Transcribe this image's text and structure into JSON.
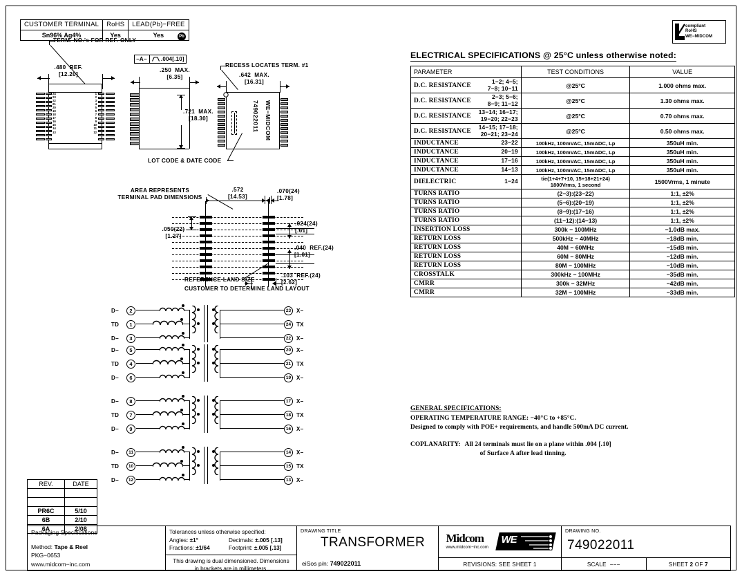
{
  "compliance": {
    "headers": [
      "CUSTOMER  TERMINAL",
      "RoHS",
      "LEAD(Pb)−FREE"
    ],
    "values": [
      "Sn96% Ag4%",
      "Yes",
      "Yes"
    ],
    "pb_badge": "Pb"
  },
  "rohs_logo": {
    "line1": "compliant",
    "line2": "RoHS",
    "line3": "WE−MIDCOM"
  },
  "mechanical": {
    "note_term_ref": "TERM. NO.'s FOR REF. ONLY",
    "note_recess": "RECESS LOCATES TERM. #1",
    "note_lotcode": "LOT CODE & DATE CODE",
    "width_ref": ".480  REF.\n[12.20]",
    "datum": "−A−",
    "flatness": ".004[.10]",
    "height_max": ".250  MAX.\n[6.35]",
    "depth_max": ".721  MAX.\n[18.30]",
    "len_max": ".642  MAX.\n[16.31]",
    "body_brand": "WE−MIDCOM",
    "body_pn": "749022011",
    "terminals_left": [
      "24",
      "23",
      "22",
      "21",
      "20",
      "19",
      "18",
      "17",
      "16",
      "15",
      "14",
      "13"
    ],
    "terminals_right": [
      "1",
      "2",
      "3",
      "4",
      "5",
      "6",
      "7",
      "8",
      "9",
      "10",
      "11",
      "12"
    ]
  },
  "land": {
    "note_area": "AREA REPRESENTS\nTERMINAL PAD DIMENSIONS",
    "note_ref_land": "REFERENCE LAND SIZE",
    "note_customer": "CUSTOMER TO DETERMINE LAND LAYOUT",
    "dim_pitch_row": ".572\n[14.53]",
    "dim_pad_w": ".070(24)\n[1.78]",
    "dim_pad_h": ".024(24)\n[.61]",
    "dim_pitch_col": ".050(22)\n[1.27]",
    "dim_ref_040": ".040  REF.(24)\n[1.01]",
    "dim_ref_103": ".103  REF.(24)\n[2.62]"
  },
  "schematic": {
    "groups": [
      {
        "rows": [
          {
            "left_sig": "D−",
            "left_pin": "2",
            "right_pin": "23",
            "right_sig": "X−"
          },
          {
            "left_sig": "TD",
            "left_pin": "1",
            "right_pin": "24",
            "right_sig": "TX"
          },
          {
            "left_sig": "D−",
            "left_pin": "3",
            "right_pin": "22",
            "right_sig": "X−"
          }
        ]
      },
      {
        "rows": [
          {
            "left_sig": "D−",
            "left_pin": "5",
            "right_pin": "20",
            "right_sig": "X−"
          },
          {
            "left_sig": "TD",
            "left_pin": "4",
            "right_pin": "21",
            "right_sig": "TX"
          },
          {
            "left_sig": "D−",
            "left_pin": "6",
            "right_pin": "19",
            "right_sig": "X−"
          }
        ]
      },
      {
        "rows": [
          {
            "left_sig": "D−",
            "left_pin": "8",
            "right_pin": "17",
            "right_sig": "X−"
          },
          {
            "left_sig": "TD",
            "left_pin": "7",
            "right_pin": "18",
            "right_sig": "TX"
          },
          {
            "left_sig": "D−",
            "left_pin": "9",
            "right_pin": "16",
            "right_sig": "X−"
          }
        ]
      },
      {
        "rows": [
          {
            "left_sig": "D−",
            "left_pin": "11",
            "right_pin": "14",
            "right_sig": "X−"
          },
          {
            "left_sig": "TD",
            "left_pin": "10",
            "right_pin": "15",
            "right_sig": "TX"
          },
          {
            "left_sig": "D−",
            "left_pin": "12",
            "right_pin": "13",
            "right_sig": "X−"
          }
        ]
      }
    ]
  },
  "espec": {
    "title": "ELECTRICAL SPECIFICATIONS @ 25°C unless otherwise noted:",
    "columns": [
      "PARAMETER",
      "TEST CONDITIONS",
      "VALUE"
    ],
    "rows": [
      {
        "param": "D.C. RESISTANCE",
        "pins": "1−2; 4−5;\n7−8; 10−11",
        "cond": "@25°C",
        "value": "1.000 ohms max."
      },
      {
        "param": "D.C. RESISTANCE",
        "pins": "2−3; 5−6;\n8−9; 11−12",
        "cond": "@25°C",
        "value": "1.30 ohms max."
      },
      {
        "param": "D.C. RESISTANCE",
        "pins": "13−14; 16−17;\n19−20; 22−23",
        "cond": "@25°C",
        "value": "0.70 ohms max."
      },
      {
        "param": "D.C. RESISTANCE",
        "pins": "14−15; 17−18;\n20−21; 23−24",
        "cond": "@25°C",
        "value": "0.50 ohms max."
      },
      {
        "param": "INDUCTANCE",
        "pins": "23−22",
        "cond": "100kHz, 100mVAC, 15mADC, Lp",
        "value": "350uH min."
      },
      {
        "param": "INDUCTANCE",
        "pins": "20−19",
        "cond": "100kHz, 100mVAC, 15mADC, Lp",
        "value": "350uH min."
      },
      {
        "param": "INDUCTANCE",
        "pins": "17−16",
        "cond": "100kHz, 100mVAC, 15mADC, Lp",
        "value": "350uH min."
      },
      {
        "param": "INDUCTANCE",
        "pins": "14−13",
        "cond": "100kHz, 100mVAC, 15mADC, Lp",
        "value": "350uH min."
      },
      {
        "param": "DIELECTRIC",
        "pins": "1−24",
        "cond": "tie(1+4+7+10, 15+18+21+24)\n1800Vrms, 1 second",
        "value": "1500Vrms, 1 minute"
      },
      {
        "param": "TURNS RATIO",
        "pins": "",
        "cond": "(2−3):(23−22)",
        "value": "1:1, ±2%"
      },
      {
        "param": "TURNS RATIO",
        "pins": "",
        "cond": "(5−6):(20−19)",
        "value": "1:1, ±2%"
      },
      {
        "param": "TURNS RATIO",
        "pins": "",
        "cond": "(8−9):(17−16)",
        "value": "1:1, ±2%"
      },
      {
        "param": "TURNS RATIO",
        "pins": "",
        "cond": "(11−12):(14−13)",
        "value": "1:1, ±2%"
      },
      {
        "param": "INSERTION LOSS",
        "pins": "",
        "cond": "300k − 100MHz",
        "value": "−1.0dB max."
      },
      {
        "param": "RETURN LOSS",
        "pins": "",
        "cond": "500kHz − 40MHz",
        "value": "−18dB min."
      },
      {
        "param": "RETURN LOSS",
        "pins": "",
        "cond": "40M − 60MHz",
        "value": "−15dB min."
      },
      {
        "param": "RETURN LOSS",
        "pins": "",
        "cond": "60M − 80MHz",
        "value": "−12dB min."
      },
      {
        "param": "RETURN LOSS",
        "pins": "",
        "cond": "80M − 100MHz",
        "value": "−10dB min."
      },
      {
        "param": "CROSSTALK",
        "pins": "",
        "cond": "300kHz − 100MHz",
        "value": "−35dB min."
      },
      {
        "param": "CMRR",
        "pins": "",
        "cond": "300k − 32MHz",
        "value": "−42dB min."
      },
      {
        "param": "CMRR",
        "pins": "",
        "cond": "32M − 100MHz",
        "value": "−33dB min."
      }
    ]
  },
  "genspec": {
    "title": "GENERAL SPECIFICATIONS:",
    "line1": "OPERATING TEMPERATURE RANGE: −40°C to +85°C.",
    "line2": "Designed to comply with POE+ requirements, and handle 500mA DC current.",
    "coplanarity_key": "COPLANARITY:",
    "coplanarity_l1": "All 24 terminals must lie on a plane within .004 [.10]",
    "coplanarity_l2": "of Surface A after lead tinning."
  },
  "revisions": {
    "headers": [
      "REV.",
      "DATE"
    ],
    "rows": [
      {
        "rev": "",
        "date": ""
      },
      {
        "rev": "",
        "date": ""
      },
      {
        "rev": "PR6C",
        "date": "5/10"
      },
      {
        "rev": "6B",
        "date": "2/10"
      },
      {
        "rev": "6A",
        "date": "2/08"
      }
    ]
  },
  "titleblock": {
    "packaging_title": "Packaging Specifications",
    "packaging_method_key": "Method:",
    "packaging_method_val": "Tape & Reel",
    "packaging_pkg": "PKG−0653",
    "packaging_web": "www.midcom−inc.com",
    "tolerance_head": "Tolerances unless otherwise specified:",
    "tolerance_angles_k": "Angles:",
    "tolerance_angles_v": "±1°",
    "tolerance_decimals_k": "Decimals:",
    "tolerance_decimals_v": "±.005 [.13]",
    "tolerance_fractions_k": "Fractions:",
    "tolerance_fractions_v": "±1/64",
    "tolerance_footprint_k": "Footprint:",
    "tolerance_footprint_v": "±.005 [.13]",
    "dual_dim_l1": "This drawing is dual dimensioned.  Dimensions",
    "dual_dim_l2": "in brackets are in millimeters.",
    "drawing_title_cap": "DRAWING TITLE",
    "drawing_title": "TRANSFORMER",
    "eisos_key": "eiSos p/n:",
    "eisos_val": "749022011",
    "logo_name": "Midcom",
    "logo_we": "WE",
    "logo_web": "www.midcom−inc.com",
    "revisions_note": "REVISIONS: SEE SHEET 1",
    "drawing_no_cap": "DRAWING NO.",
    "drawing_no": "749022011",
    "scale_key": "SCALE",
    "scale_val": "−−−",
    "sheet_key": "SHEET",
    "sheet_num": "2",
    "sheet_of": "OF",
    "sheet_total": "7"
  }
}
